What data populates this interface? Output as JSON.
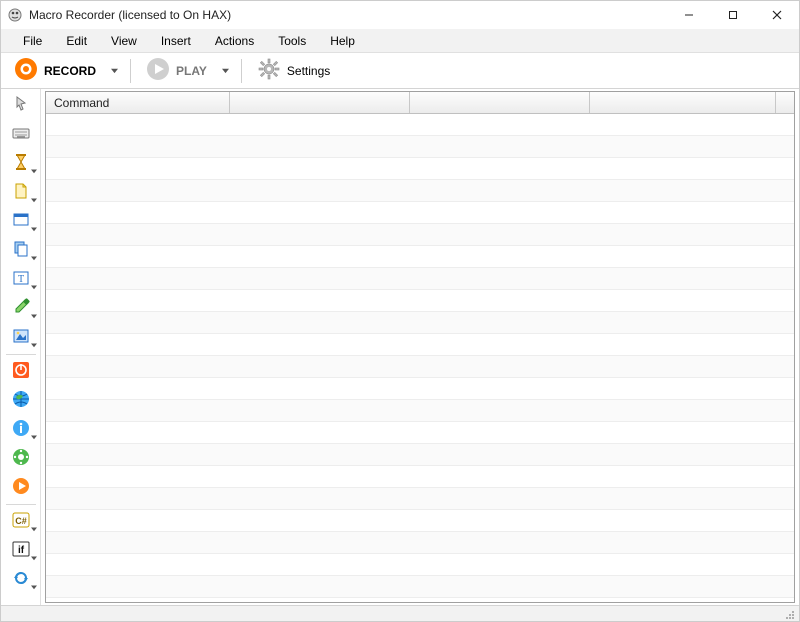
{
  "title": "Macro Recorder (licensed to On HAX)",
  "menu": {
    "file": "File",
    "edit": "Edit",
    "view": "View",
    "insert": "Insert",
    "actions": "Actions",
    "tools": "Tools",
    "help": "Help"
  },
  "toolbar": {
    "record": "RECORD",
    "play": "PLAY",
    "settings": "Settings"
  },
  "grid": {
    "column0": "Command"
  },
  "rows": []
}
